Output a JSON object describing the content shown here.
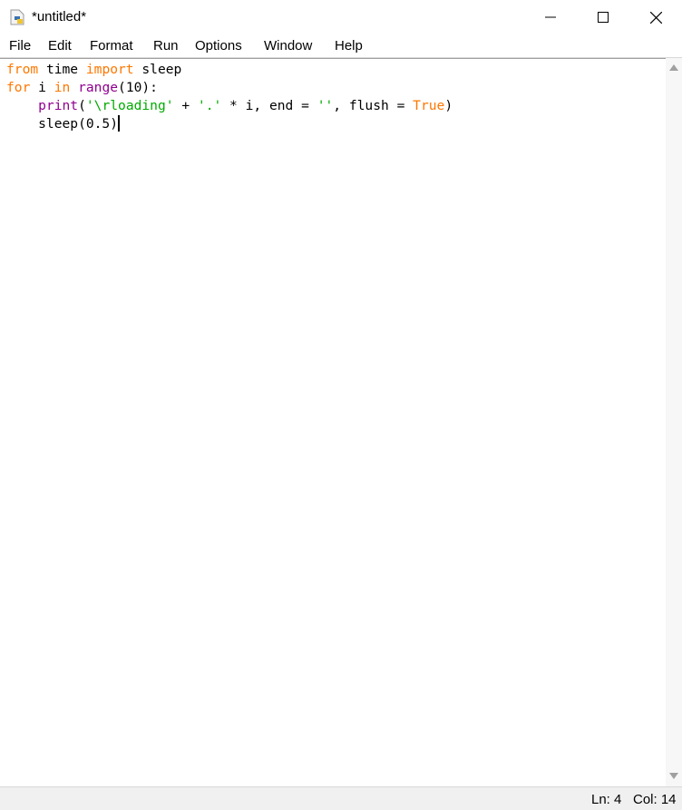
{
  "window": {
    "title": "*untitled*"
  },
  "menu": [
    "File",
    "Edit",
    "Format",
    "Run",
    "Options",
    "Window",
    "Help"
  ],
  "editor": {
    "lines": [
      [
        {
          "t": "from",
          "c": "kw"
        },
        {
          "t": " time "
        },
        {
          "t": "import",
          "c": "kw"
        },
        {
          "t": " sleep"
        }
      ],
      [
        {
          "t": "for",
          "c": "kw"
        },
        {
          "t": " i "
        },
        {
          "t": "in",
          "c": "kw"
        },
        {
          "t": " "
        },
        {
          "t": "range",
          "c": "bi"
        },
        {
          "t": "(10):"
        }
      ],
      [
        {
          "t": "    "
        },
        {
          "t": "print",
          "c": "bi"
        },
        {
          "t": "("
        },
        {
          "t": "'\\rloading'",
          "c": "st"
        },
        {
          "t": " + "
        },
        {
          "t": "'.'",
          "c": "st"
        },
        {
          "t": " * i, end = "
        },
        {
          "t": "''",
          "c": "st"
        },
        {
          "t": ", flush = "
        },
        {
          "t": "True",
          "c": "kw"
        },
        {
          "t": ")"
        }
      ],
      [
        {
          "t": "    sleep(0.5)"
        }
      ]
    ]
  },
  "status": {
    "line": "Ln: 4",
    "col": "Col: 14"
  },
  "colors": {
    "keyword": "#ff7700",
    "builtin": "#900090",
    "string": "#00aa00"
  }
}
